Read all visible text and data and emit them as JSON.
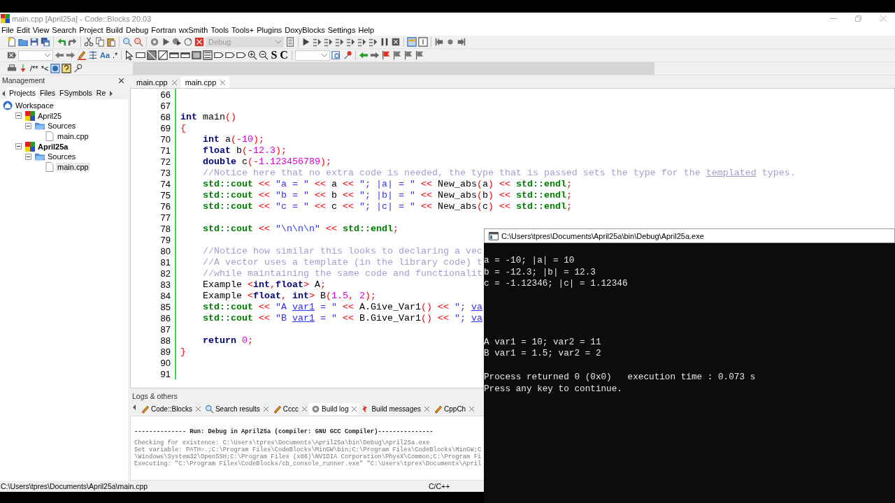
{
  "window": {
    "title": "main.cpp [April25a] - Code::Blocks 20.03"
  },
  "menu": [
    "File",
    "Edit",
    "View",
    "Search",
    "Project",
    "Build",
    "Debug",
    "Fortran",
    "wxSmith",
    "Tools",
    "Tools+",
    "Plugins",
    "DoxyBlocks",
    "Settings",
    "Help"
  ],
  "toolbars": {
    "build_target": {
      "value": "Debug",
      "disabled": true
    },
    "row2_texts": [
      "Aa",
      ".*",
      "S",
      "C"
    ],
    "row3_texts": [
      "/**",
      "*<"
    ]
  },
  "management": {
    "title": "Management",
    "tabs": [
      {
        "label": "Projects",
        "selected": true
      },
      {
        "label": "Files",
        "selected": false
      },
      {
        "label": "FSymbols",
        "selected": false
      },
      {
        "label": "Re",
        "selected": false
      }
    ],
    "tree": [
      {
        "label": "Workspace",
        "kind": "workspace",
        "active": false,
        "selected": false,
        "children": [
          {
            "label": "April25",
            "kind": "project",
            "active": false,
            "selected": false,
            "children": [
              {
                "label": "Sources",
                "kind": "folder",
                "active": false,
                "selected": false,
                "children": [
                  {
                    "label": "main.cpp",
                    "kind": "file",
                    "active": false,
                    "selected": false
                  }
                ]
              }
            ]
          },
          {
            "label": "April25a",
            "kind": "project",
            "active": true,
            "selected": false,
            "children": [
              {
                "label": "Sources",
                "kind": "folder",
                "active": false,
                "selected": false,
                "children": [
                  {
                    "label": "main.cpp",
                    "kind": "file",
                    "active": false,
                    "selected": true
                  }
                ]
              }
            ]
          }
        ]
      }
    ]
  },
  "editor": {
    "tabs": [
      {
        "label": "main.cpp",
        "selected": false
      },
      {
        "label": "main.cpp",
        "selected": true
      }
    ],
    "lines": [
      {
        "number": "66"
      },
      {
        "number": "67"
      },
      {
        "number": "68",
        "tokens": [
          {
            "kind": "kw",
            "text": "int"
          },
          {
            "kind": "plain",
            "text": " main"
          },
          {
            "kind": "op",
            "text": "()"
          }
        ]
      },
      {
        "number": "69",
        "tokens": [
          {
            "kind": "op",
            "text": "{"
          }
        ]
      },
      {
        "number": "70",
        "tokens": [
          {
            "kind": "kw",
            "text": "    int"
          },
          {
            "kind": "plain",
            "text": " a"
          },
          {
            "kind": "op",
            "text": "(-"
          },
          {
            "kind": "num",
            "text": "10"
          },
          {
            "kind": "op",
            "text": ");"
          }
        ]
      },
      {
        "number": "71",
        "tokens": [
          {
            "kind": "kw",
            "text": "    float"
          },
          {
            "kind": "plain",
            "text": " b"
          },
          {
            "kind": "op",
            "text": "(-"
          },
          {
            "kind": "num",
            "text": "12.3"
          },
          {
            "kind": "op",
            "text": ");"
          }
        ]
      },
      {
        "number": "72",
        "tokens": [
          {
            "kind": "kw",
            "text": "    double"
          },
          {
            "kind": "plain",
            "text": " c"
          },
          {
            "kind": "op",
            "text": "(-"
          },
          {
            "kind": "num",
            "text": "1.123456789"
          },
          {
            "kind": "op",
            "text": ");"
          }
        ]
      },
      {
        "number": "73",
        "tokens": [
          {
            "kind": "comment",
            "text": "    //Notice here that no extra code is needed, the type that is passed sets the type for the "
          },
          {
            "kind": "spell",
            "text": "templated"
          },
          {
            "kind": "comment",
            "text": " types."
          }
        ]
      },
      {
        "number": "74",
        "tokens": [
          {
            "kind": "std",
            "text": "    std::cout"
          },
          {
            "kind": "op",
            "text": " << "
          },
          {
            "kind": "str",
            "text": "\"a = \""
          },
          {
            "kind": "op",
            "text": " << "
          },
          {
            "kind": "plain",
            "text": "a"
          },
          {
            "kind": "op",
            "text": " << "
          },
          {
            "kind": "str",
            "text": "\"; |a| = \""
          },
          {
            "kind": "op",
            "text": " << "
          },
          {
            "kind": "plain",
            "text": "New_abs"
          },
          {
            "kind": "op",
            "text": "("
          },
          {
            "kind": "plain",
            "text": "a"
          },
          {
            "kind": "op",
            "text": ") << "
          },
          {
            "kind": "std",
            "text": "std::endl"
          },
          {
            "kind": "op",
            "text": ";"
          }
        ]
      },
      {
        "number": "75",
        "tokens": [
          {
            "kind": "std",
            "text": "    std::cout"
          },
          {
            "kind": "op",
            "text": " << "
          },
          {
            "kind": "str",
            "text": "\"b = \""
          },
          {
            "kind": "op",
            "text": " << "
          },
          {
            "kind": "plain",
            "text": "b"
          },
          {
            "kind": "op",
            "text": " << "
          },
          {
            "kind": "str",
            "text": "\"; |b| = \""
          },
          {
            "kind": "op",
            "text": " << "
          },
          {
            "kind": "plain",
            "text": "New_abs"
          },
          {
            "kind": "op",
            "text": "("
          },
          {
            "kind": "plain",
            "text": "b"
          },
          {
            "kind": "op",
            "text": ") << "
          },
          {
            "kind": "std",
            "text": "std::endl"
          },
          {
            "kind": "op",
            "text": ";"
          }
        ]
      },
      {
        "number": "76",
        "tokens": [
          {
            "kind": "std",
            "text": "    std::cout"
          },
          {
            "kind": "op",
            "text": " << "
          },
          {
            "kind": "str",
            "text": "\"c = \""
          },
          {
            "kind": "op",
            "text": " << "
          },
          {
            "kind": "plain",
            "text": "c"
          },
          {
            "kind": "op",
            "text": " << "
          },
          {
            "kind": "str",
            "text": "\"; |c| = \""
          },
          {
            "kind": "op",
            "text": " << "
          },
          {
            "kind": "plain",
            "text": "New_abs"
          },
          {
            "kind": "op",
            "text": "("
          },
          {
            "kind": "plain",
            "text": "c"
          },
          {
            "kind": "op",
            "text": ") << "
          },
          {
            "kind": "std",
            "text": "std::endl"
          },
          {
            "kind": "op",
            "text": ";"
          }
        ]
      },
      {
        "number": "77"
      },
      {
        "number": "78",
        "tokens": [
          {
            "kind": "std",
            "text": "    std::cout"
          },
          {
            "kind": "op",
            "text": " << "
          },
          {
            "kind": "str",
            "text": "\"\\n\\n\\n\""
          },
          {
            "kind": "op",
            "text": " << "
          },
          {
            "kind": "std",
            "text": "std::endl"
          },
          {
            "kind": "op",
            "text": ";"
          }
        ]
      },
      {
        "number": "79"
      },
      {
        "number": "80",
        "tokens": [
          {
            "kind": "comment",
            "text": "    //Notice how similar this looks to declaring a vec"
          }
        ]
      },
      {
        "number": "81",
        "tokens": [
          {
            "kind": "comment",
            "text": "    //A vector uses a template (in the library code) t"
          }
        ]
      },
      {
        "number": "82",
        "tokens": [
          {
            "kind": "comment",
            "text": "    //while maintaining the same code and functionalit"
          }
        ]
      },
      {
        "number": "83",
        "tokens": [
          {
            "kind": "plain",
            "text": "    Example "
          },
          {
            "kind": "op",
            "text": "<"
          },
          {
            "kind": "kw",
            "text": "int"
          },
          {
            "kind": "op",
            "text": ","
          },
          {
            "kind": "kw",
            "text": "float"
          },
          {
            "kind": "op",
            "text": ">"
          },
          {
            "kind": "plain",
            "text": " A"
          },
          {
            "kind": "op",
            "text": ";"
          }
        ]
      },
      {
        "number": "84",
        "tokens": [
          {
            "kind": "plain",
            "text": "    Example "
          },
          {
            "kind": "op",
            "text": "<"
          },
          {
            "kind": "kw",
            "text": "float"
          },
          {
            "kind": "op",
            "text": ", "
          },
          {
            "kind": "kw",
            "text": "int"
          },
          {
            "kind": "op",
            "text": ">"
          },
          {
            "kind": "plain",
            "text": " B"
          },
          {
            "kind": "op",
            "text": "("
          },
          {
            "kind": "num",
            "text": "1.5"
          },
          {
            "kind": "op",
            "text": ", "
          },
          {
            "kind": "num",
            "text": "2"
          },
          {
            "kind": "op",
            "text": ");"
          }
        ]
      },
      {
        "number": "85",
        "tokens": [
          {
            "kind": "std",
            "text": "    std::cout"
          },
          {
            "kind": "op",
            "text": " << "
          },
          {
            "kind": "str",
            "text": "\"A "
          },
          {
            "kind": "strspell",
            "text": "var1"
          },
          {
            "kind": "str",
            "text": " = \""
          },
          {
            "kind": "op",
            "text": " << "
          },
          {
            "kind": "plain",
            "text": "A.Give_Var1"
          },
          {
            "kind": "op",
            "text": "() << "
          },
          {
            "kind": "str",
            "text": "\"; "
          },
          {
            "kind": "strspell",
            "text": "va"
          }
        ]
      },
      {
        "number": "86",
        "tokens": [
          {
            "kind": "std",
            "text": "    std::cout"
          },
          {
            "kind": "op",
            "text": " << "
          },
          {
            "kind": "str",
            "text": "\"B "
          },
          {
            "kind": "strspell",
            "text": "var1"
          },
          {
            "kind": "str",
            "text": " = \""
          },
          {
            "kind": "op",
            "text": " << "
          },
          {
            "kind": "plain",
            "text": "B.Give_Var1"
          },
          {
            "kind": "op",
            "text": "() << "
          },
          {
            "kind": "str",
            "text": "\"; "
          },
          {
            "kind": "strspell",
            "text": "va"
          }
        ]
      },
      {
        "number": "87"
      },
      {
        "number": "88",
        "tokens": [
          {
            "kind": "kw",
            "text": "    return "
          },
          {
            "kind": "num",
            "text": "0"
          },
          {
            "kind": "op",
            "text": ";"
          }
        ]
      },
      {
        "number": "89",
        "tokens": [
          {
            "kind": "op",
            "text": "}"
          }
        ]
      },
      {
        "number": "90"
      },
      {
        "number": "91"
      }
    ]
  },
  "logs": {
    "title": "Logs & others",
    "tabs": [
      {
        "label": "Code::Blocks",
        "selected": false
      },
      {
        "label": "Search results",
        "selected": false
      },
      {
        "label": "Cccc",
        "selected": false
      },
      {
        "label": "Build log",
        "selected": true
      },
      {
        "label": "Build messages",
        "selected": false
      },
      {
        "label": "CppCh",
        "selected": false
      }
    ],
    "lines": [
      {
        "kind": "header",
        "text": "-------------- Run: Debug in April25a (compiler: GNU GCC Compiler)---------------"
      },
      {
        "kind": "plain",
        "text": "Checking for existence: C:\\Users\\tpres\\Documents\\April25a\\bin\\Debug\\April25a.exe"
      },
      {
        "kind": "plain",
        "text": "Set variable: PATH=.;C:\\Program Files\\CodeBlocks\\MinGW\\bin;C:\\Program Files\\CodeBlocks\\MinGW;C"
      },
      {
        "kind": "plain",
        "text": "\\Windows\\System32\\OpenSSH;C:\\Program Files (x86)\\NVIDIA Corporation\\PhysX\\Common;C:\\Program Fi"
      },
      {
        "kind": "plain",
        "text": "Executing: \"C:\\Program Files\\CodeBlocks/cb_console_runner.exe\" \"C:\\Users\\tpres\\Documents\\April"
      }
    ]
  },
  "status_bar": {
    "path": "C:\\Users\\tpres\\Documents\\April25a\\main.cpp",
    "language": "C/C++"
  },
  "console": {
    "title": "C:\\Users\\tpres\\Documents\\April25a\\bin\\Debug\\April25a.exe",
    "blocks": [
      [
        "a = -10; |a| = 10",
        "b = -12.3; |b| = 12.3",
        "c = -1.12346; |c| = 1.12346"
      ],
      [
        "A var1 = 10; var2 = 11",
        "B var1 = 1.5; var2 = 2"
      ],
      [
        "Process returned 0 (0x0)   execution time : 0.073 s",
        "Press any key to continue."
      ]
    ]
  }
}
